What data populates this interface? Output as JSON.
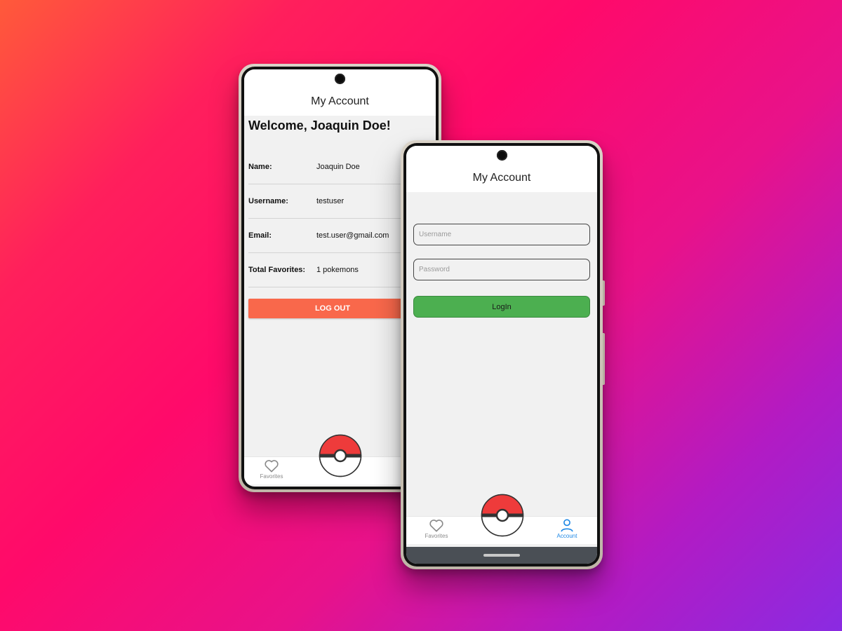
{
  "accent_colors": {
    "logout": "#f9684b",
    "login": "#4caf50",
    "active_tab": "#1e88e5",
    "pokeball_red": "#ee3b3b"
  },
  "account_screen": {
    "title": "My Account",
    "welcome": "Welcome, Joaquin Doe!",
    "fields": [
      {
        "label": "Name:",
        "value": "Joaquin Doe"
      },
      {
        "label": "Username:",
        "value": "testuser"
      },
      {
        "label": "Email:",
        "value": "test.user@gmail.com"
      },
      {
        "label": "Total Favorites:",
        "value": "1 pokemons"
      }
    ],
    "logout_label": "LOG OUT",
    "tabs": {
      "favorites": "Favorites"
    }
  },
  "login_screen": {
    "title": "My Account",
    "username_placeholder": "Username",
    "password_placeholder": "Password",
    "login_label": "LogIn",
    "tabs": {
      "favorites": "Favorites",
      "account": "Account"
    }
  }
}
